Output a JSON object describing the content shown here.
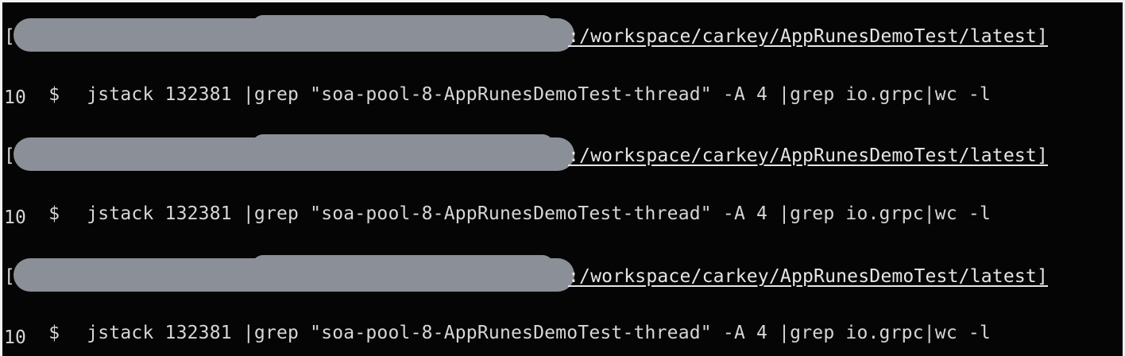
{
  "terminal": {
    "blocks": [
      {
        "path": ":/workspace/carkey/AppRunesDemoTest/latest]",
        "prompt_symbol": "$",
        "command": "jstack 132381 |grep \"soa-pool-8-AppRunesDemoTest-thread\" -A 4 |grep io.grpc|wc -l",
        "output": "10"
      },
      {
        "path": ":/workspace/carkey/AppRunesDemoTest/latest]",
        "prompt_symbol": "$",
        "command": "jstack 132381 |grep \"soa-pool-8-AppRunesDemoTest-thread\" -A 4 |grep io.grpc|wc -l",
        "output": "10"
      },
      {
        "path": ":/workspace/carkey/AppRunesDemoTest/latest]",
        "prompt_symbol": "$",
        "command": "jstack 132381 |grep \"soa-pool-8-AppRunesDemoTest-thread\" -A 4 |grep io.grpc|wc -l",
        "output": "10"
      }
    ],
    "bracket_open": "[",
    "colors": {
      "background": "#050505",
      "text": "#d6d6d6",
      "redaction": "#8b8f97",
      "prompt_green": "#3fbf3f"
    }
  }
}
